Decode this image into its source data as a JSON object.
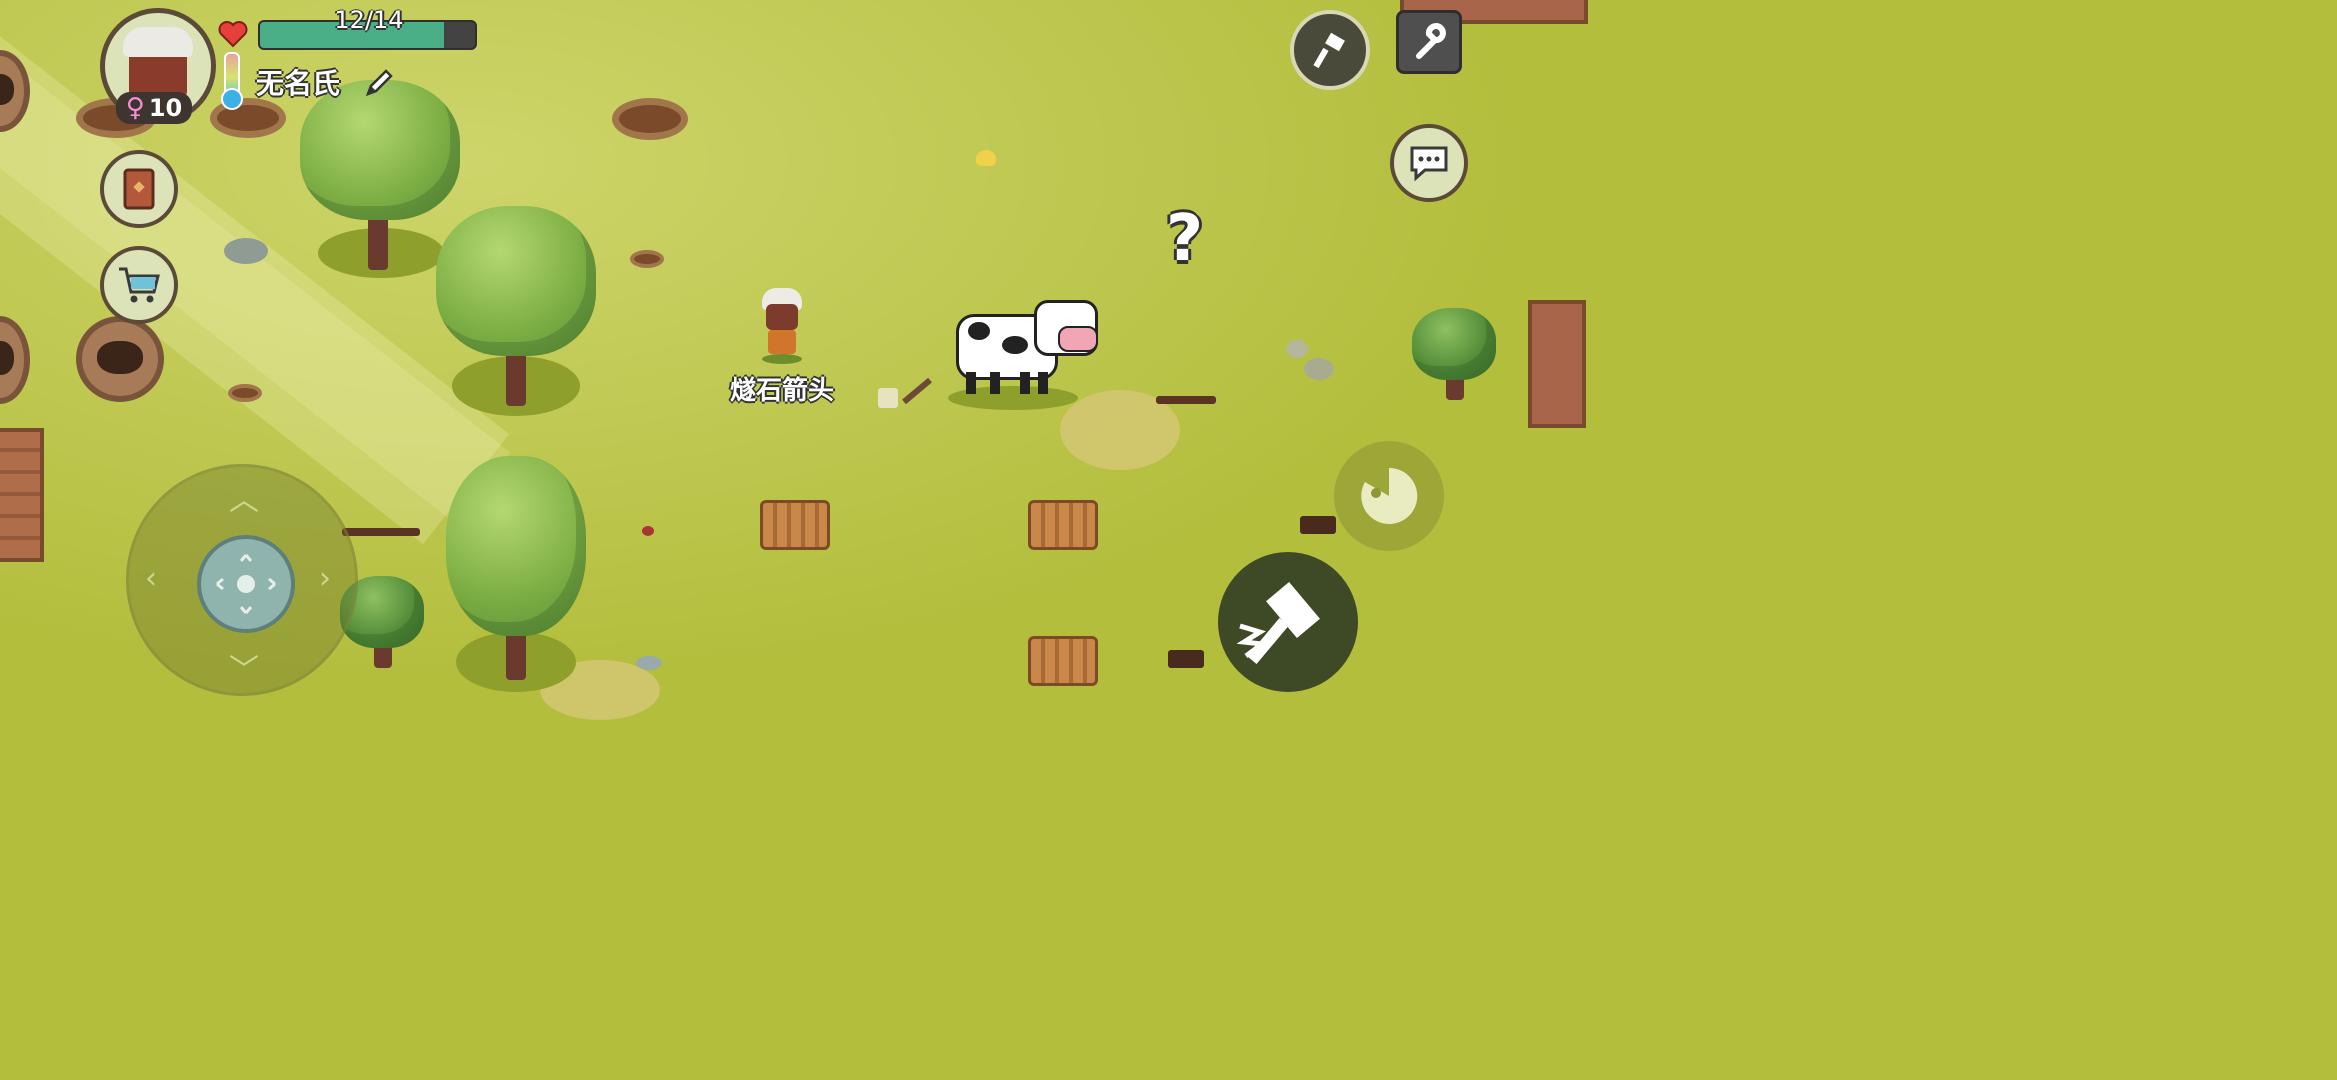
{
  "player": {
    "name": "无名氏",
    "gender_symbol": "♀",
    "age": "10",
    "food": "12/14",
    "food_fraction": 0.857
  },
  "world": {
    "item_label": "燧石箭头",
    "quest_marker": "?"
  },
  "hud": {
    "icons": {
      "heart": "heart-icon",
      "thermometer": "thermometer-icon",
      "edit": "pencil-icon",
      "recipe_book": "book-icon",
      "shop": "shopping-cart-icon",
      "build": "hammer-icon",
      "settings": "wrench-icon",
      "chat": "chat-bubble-icon",
      "eat": "eat-icon",
      "use": "hammer-action-icon"
    }
  },
  "colors": {
    "grass": "#b3be3d",
    "hp_fill": "#4aae86",
    "hp_track": "#434343",
    "frame": "#5b4a38"
  }
}
